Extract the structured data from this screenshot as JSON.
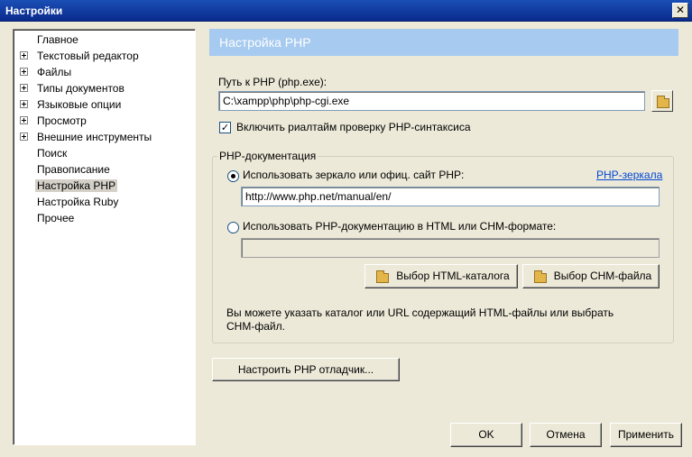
{
  "window": {
    "title": "Настройки",
    "close_glyph": "✕"
  },
  "tree": {
    "items": [
      {
        "label": "Главное",
        "expandable": false
      },
      {
        "label": "Текстовый редактор",
        "expandable": true
      },
      {
        "label": "Файлы",
        "expandable": true
      },
      {
        "label": "Типы документов",
        "expandable": true
      },
      {
        "label": "Языковые опции",
        "expandable": true
      },
      {
        "label": "Просмотр",
        "expandable": true
      },
      {
        "label": "Внешние инструменты",
        "expandable": true
      },
      {
        "label": "Поиск",
        "expandable": false
      },
      {
        "label": "Правописание",
        "expandable": false
      },
      {
        "label": "Настройка PHP",
        "expandable": false,
        "selected": true
      },
      {
        "label": "Настройка Ruby",
        "expandable": false
      },
      {
        "label": "Прочее",
        "expandable": false
      }
    ]
  },
  "panel": {
    "heading": "Настройка PHP",
    "php_path": {
      "label": "Путь к PHP (php.exe):",
      "value": "C:\\xampp\\php\\php-cgi.exe",
      "browse_icon": "folder-icon"
    },
    "realtime_check": {
      "checked": true,
      "check_glyph": "✓",
      "label": "Включить риалтайм проверку PHP-синтаксиса"
    },
    "doc_group": {
      "title": "PHP-документация",
      "mirror_option": {
        "selected": true,
        "label": "Использовать зеркало или офиц. сайт PHP:",
        "link": "PHP-зеркала",
        "url": "http://www.php.net/manual/en/"
      },
      "local_option": {
        "selected": false,
        "label": "Использовать PHP-документацию в HTML или CHM-формате:",
        "path_value": ""
      },
      "html_button": "Выбор HTML-каталога",
      "chm_button": "Выбор CHM-файла",
      "hint_line1": "Вы можете указать каталог или URL содержащий HTML-файлы или выбрать",
      "hint_line2": "CHM-файл."
    },
    "debugger_button": "Настроить PHP отладчик..."
  },
  "footer": {
    "ok": "OK",
    "cancel": "Отмена",
    "apply": "Применить"
  },
  "colors": {
    "accent_band": "#a6caf0",
    "link": "#0046d5",
    "titlebar": "#0a2a8c"
  }
}
